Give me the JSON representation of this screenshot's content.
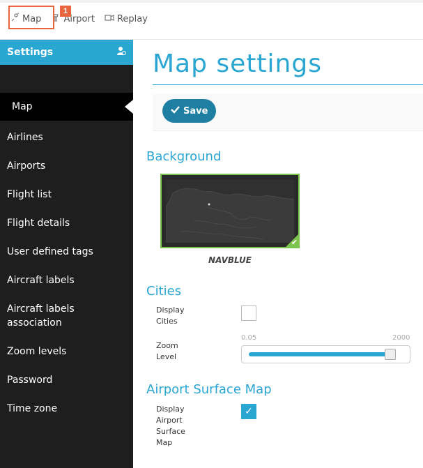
{
  "topnav": {
    "items": [
      {
        "label": "Map",
        "icon": "map-marker-icon"
      },
      {
        "label": "Airport",
        "icon": "airport-tower-icon"
      },
      {
        "label": "Replay",
        "icon": "video-camera-icon"
      }
    ],
    "badge": "1"
  },
  "sidebar": {
    "title": "Settings",
    "header_icon": "user-gear-icon",
    "items": [
      {
        "label": "Map"
      },
      {
        "label": "Airlines"
      },
      {
        "label": "Airports"
      },
      {
        "label": "Flight list"
      },
      {
        "label": "Flight details"
      },
      {
        "label": "User defined tags"
      },
      {
        "label": "Aircraft labels"
      },
      {
        "label": "Aircraft labels association"
      },
      {
        "label": "Zoom levels"
      },
      {
        "label": "Password"
      },
      {
        "label": "Time zone"
      }
    ]
  },
  "main": {
    "title": "Map settings",
    "save_label": "Save",
    "background": {
      "section_title": "Background",
      "selected": "NAVBLUE"
    },
    "cities": {
      "section_title": "Cities",
      "display_label": "Display Cities",
      "display_checked": false,
      "zoom_label": "Zoom Level",
      "zoom_min": "0.05",
      "zoom_max": "2000",
      "zoom_fraction": 0.92
    },
    "airport_surface": {
      "section_title": "Airport Surface Map",
      "display_label": "Display Airport Surface Map",
      "display_checked": true
    }
  },
  "colors": {
    "accent": "#2aa6d2",
    "save_button": "#1f7fa3",
    "highlight": "#e8643c",
    "selected_border": "#7cc44c",
    "sidebar_bg": "#1e1e1e"
  }
}
